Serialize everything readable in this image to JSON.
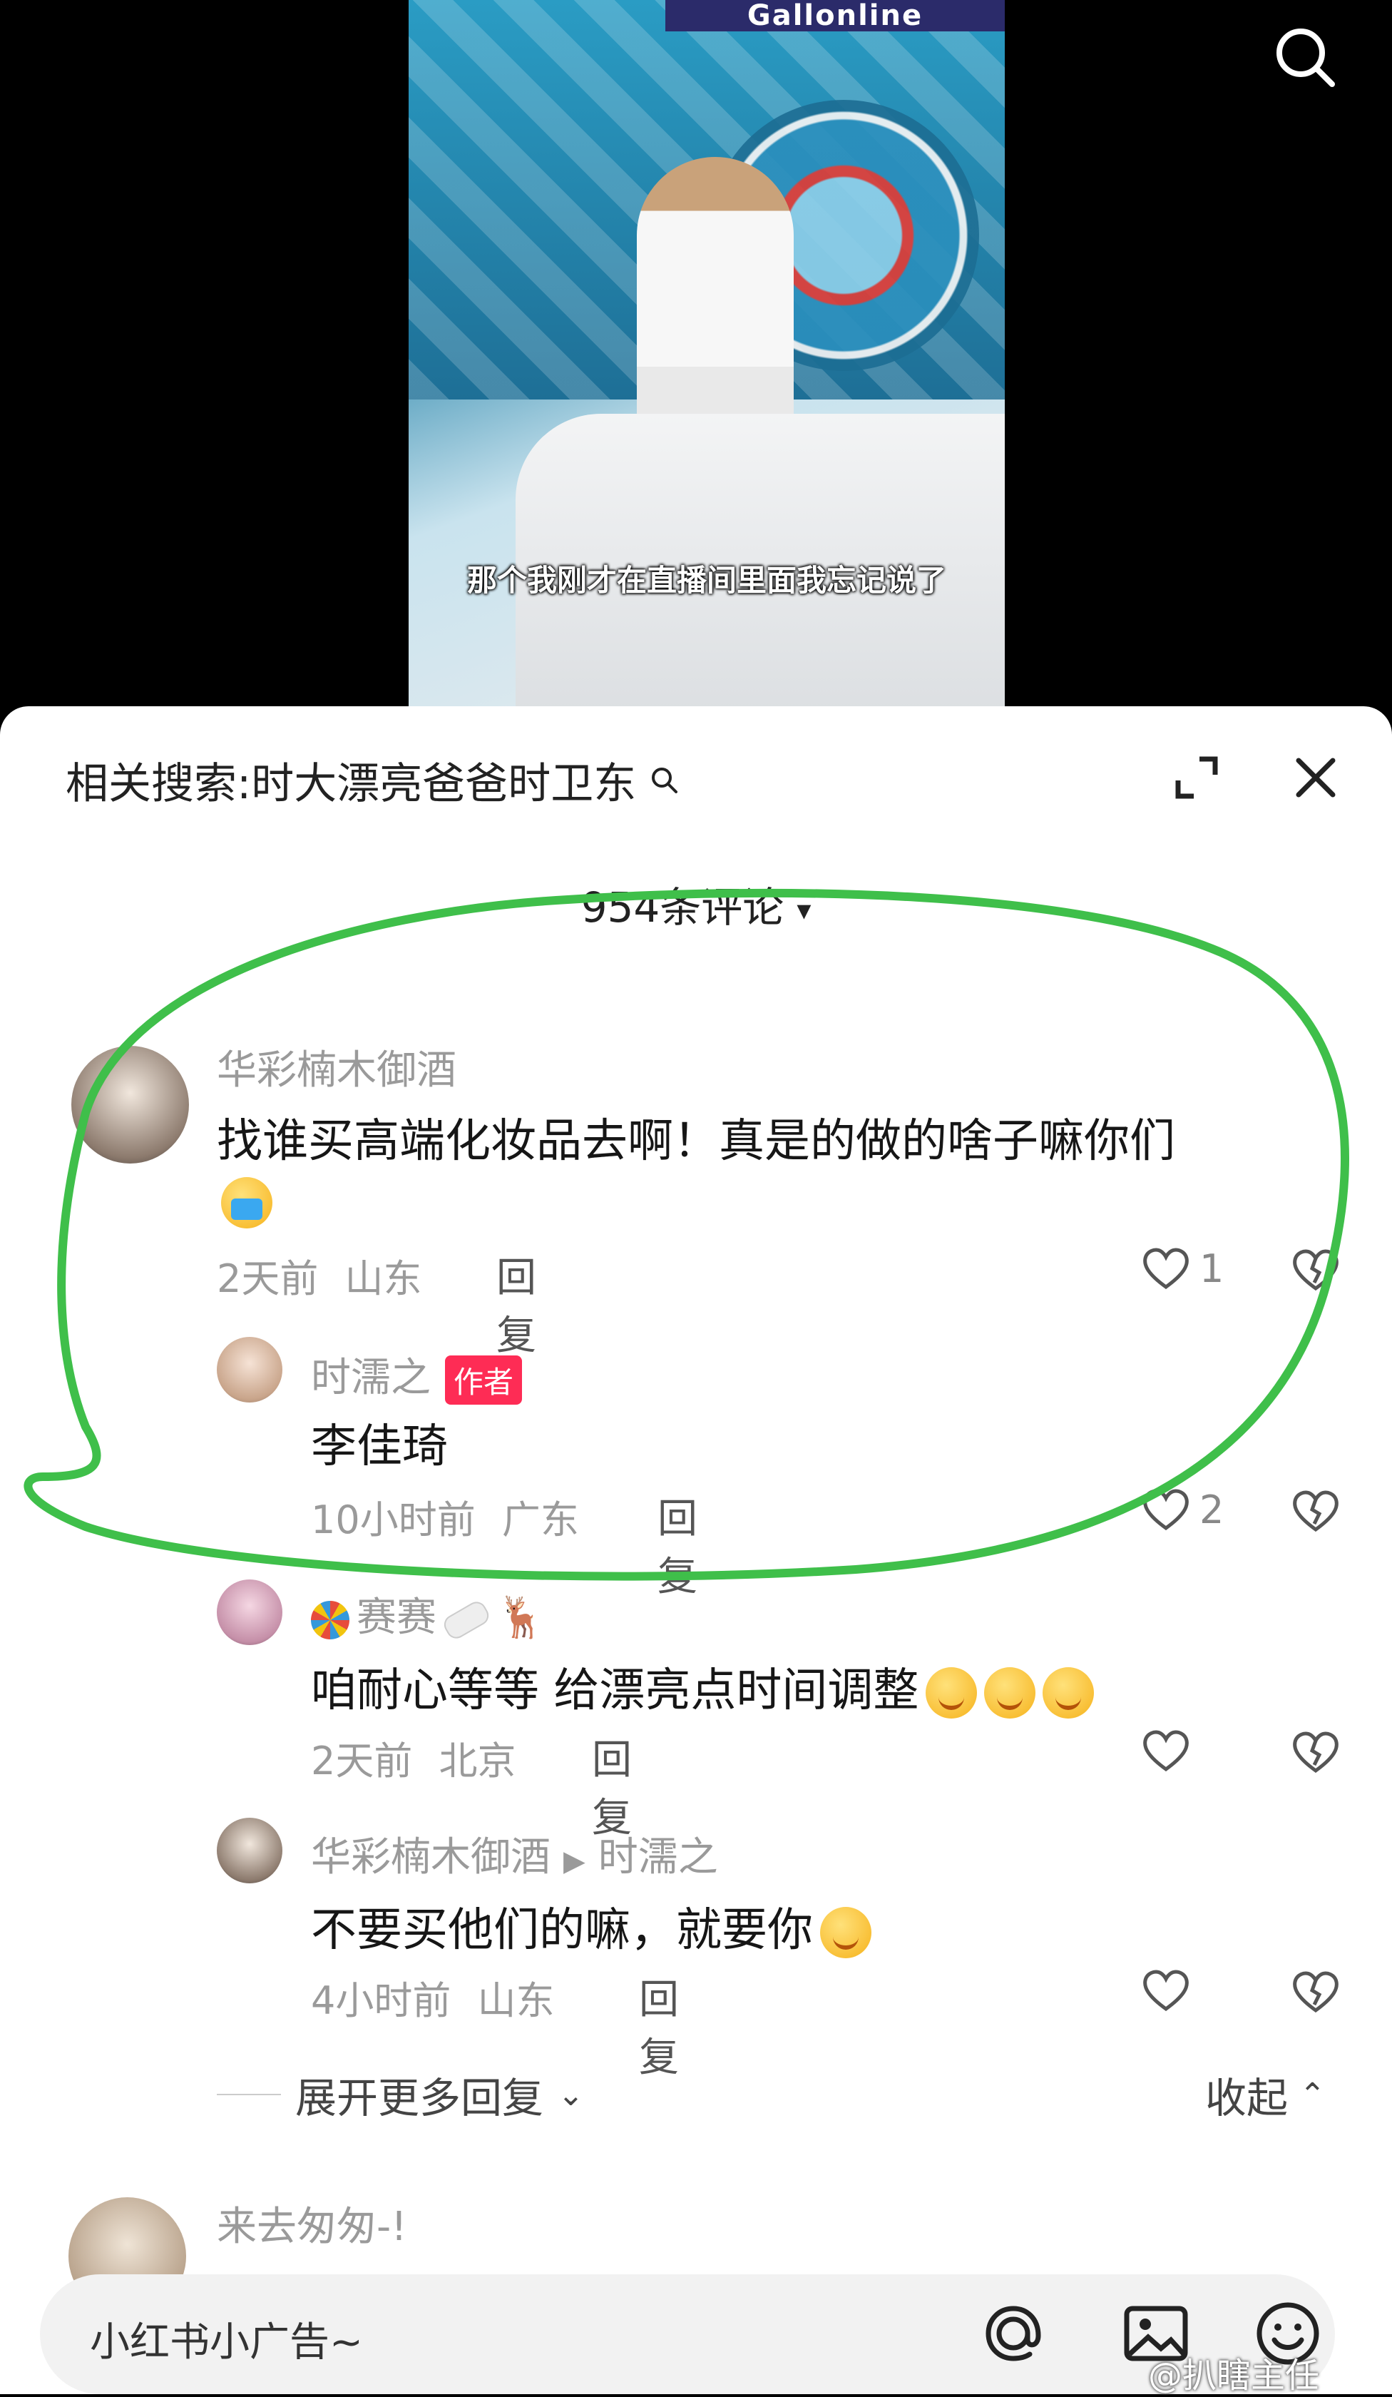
{
  "video": {
    "banner_text": "Gallonline",
    "caption": "那个我刚才在直播间里面我忘记说了"
  },
  "panel": {
    "related_search_label": "相关搜索:时大漂亮爸爸时卫东",
    "comment_count": "954条评论"
  },
  "comments": [
    {
      "name": "华彩楠木御酒",
      "text": "找谁买高端化妆品去啊！真是的做的啥子嘛你们",
      "time": "2天前",
      "location": "山东",
      "reply_label": "回复",
      "likes": "1"
    }
  ],
  "replies": [
    {
      "name": "时濡之",
      "badge": "作者",
      "text": "李佳琦",
      "time": "10小时前",
      "location": "广东",
      "reply_label": "回复",
      "likes": "2"
    },
    {
      "name": "赛赛",
      "text": "咱耐心等等 给漂亮点时间调整",
      "time": "2天前",
      "location": "北京",
      "reply_label": "回复",
      "likes": ""
    },
    {
      "name": "华彩楠木御酒",
      "reply_to": "时濡之",
      "text": "不要买他们的嘛，就要你",
      "time": "4小时前",
      "location": "山东",
      "reply_label": "回复",
      "likes": ""
    }
  ],
  "expand_more_label": "展开更多回复",
  "collapse_label": "收起",
  "next_comment": {
    "name": "来去匆匆-!"
  },
  "input": {
    "placeholder": "小红书小广告~"
  },
  "watermark": "@扒瞎主任",
  "colors": {
    "accent": "#fe2c55",
    "ring": "#3fbf4a"
  },
  "icons": [
    "search-icon",
    "expand-icon",
    "close-icon",
    "heart-icon",
    "broken-heart-icon",
    "at-icon",
    "image-icon",
    "emoji-icon"
  ]
}
